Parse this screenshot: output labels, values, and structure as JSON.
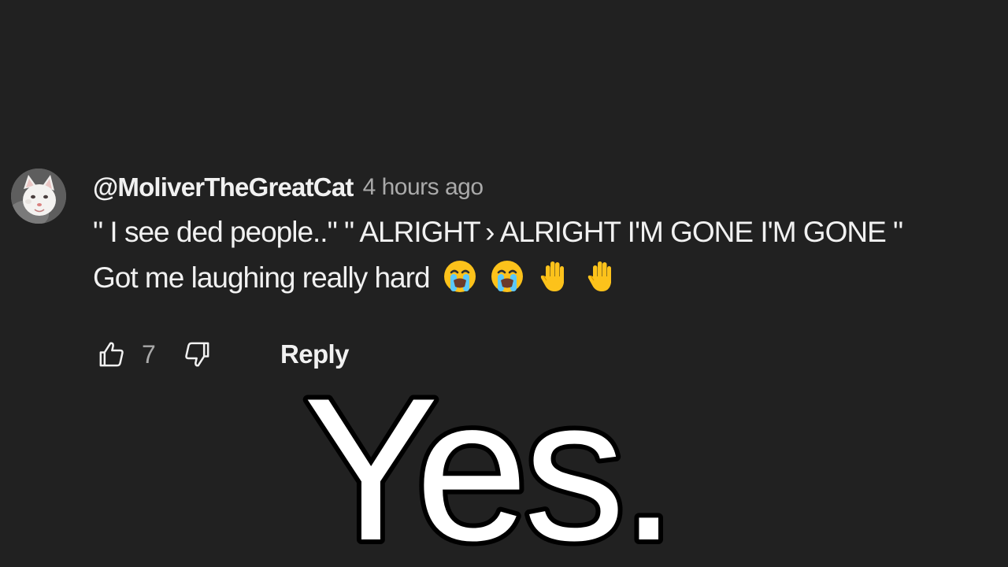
{
  "comment": {
    "author": "@MoliverTheGreatCat",
    "timestamp": "4 hours ago",
    "text_line1": "\" I see ded people..\" \" ALRIGHT › ALRIGHT I'M GONE I'M GONE \"",
    "text_line2": "Got me laughing really hard",
    "emojis": [
      "loudly-crying-face-icon",
      "loudly-crying-face-icon",
      "raised-hand-icon",
      "raised-hand-icon"
    ],
    "like_count": "7",
    "reply_label": "Reply"
  },
  "caption": {
    "text": "Yes."
  },
  "colors": {
    "background": "#212121",
    "primary_text": "#f1f1f1",
    "secondary_text": "#aaaaaa",
    "caption_fill": "#ffffff",
    "caption_outline": "#000000"
  }
}
